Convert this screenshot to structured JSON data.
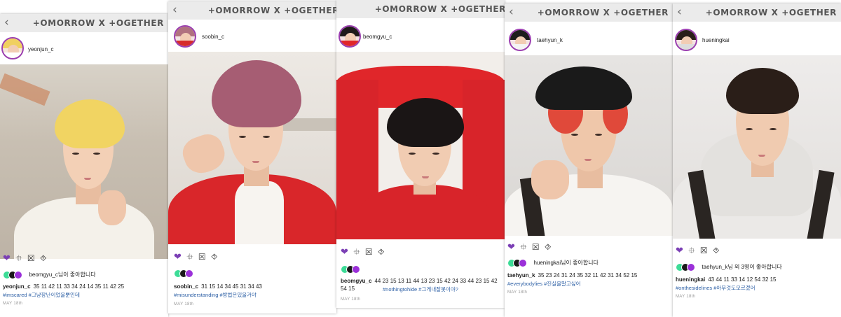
{
  "brand": "+OMORROW X +OGETHER",
  "back_glyph": "‹",
  "icons": {
    "like": "heart-icon",
    "comment": "diamond-icon",
    "dm": "cross-box-icon",
    "save": "flower-icon"
  },
  "glyphs": {
    "like": "❤",
    "comment": "⯐",
    "dm": "☒",
    "save": "⯑"
  },
  "colors": {
    "avatar_ring": "#9b3fb0",
    "hashtag": "#2f61a6",
    "like_dots": [
      "#3ddc97",
      "#1a1a1a",
      "#9b30d9"
    ]
  },
  "posts": [
    {
      "username": "yeonjun_c",
      "likes_text": "beomgyu_c님이 좋아합니다",
      "caption_user": "yeonjun_c",
      "caption_text": "35 11 42 11 33 34 24 14   35 11 42 25",
      "hashtags": "#imscared #그냥장난이었을뿐인데",
      "date": "MAY 18th"
    },
    {
      "username": "soobin_c",
      "likes_text": "",
      "caption_user": "soobin_c",
      "caption_text": "31 15 14 34 45 31 34 43",
      "hashtags": "#misunderstanding #방법은있을거야",
      "date": "MAY 18th"
    },
    {
      "username": "beomgyu_c",
      "likes_text": "",
      "caption_user": "beomgyu_c",
      "caption_text": "44 23 15   13 11 44 13 23 15 42   24 33   44 23 15 42 54 15",
      "hashtags": "#nothingtohide #그게내잘못이야?",
      "date": "MAY 18th"
    },
    {
      "username": "taehyun_k",
      "likes_text": "hueningkai님이 좋아합니다",
      "caption_user": "taehyun_k",
      "caption_text": "35 23 24 31 24 35   32 11 42 31 34 52 15",
      "hashtags": "#everybodylies #진실을말고싶어",
      "date": "MAY 18th"
    },
    {
      "username": "hueningkai",
      "likes_text": "taehyun_k님 외 3명이 좋아합니다",
      "caption_user": "hueningkai",
      "caption_text": "43 44 11 33 14   12 54   32 15",
      "hashtags": "#onthesidelines #아무것도모르겠어",
      "date": "MAY 18th"
    }
  ]
}
